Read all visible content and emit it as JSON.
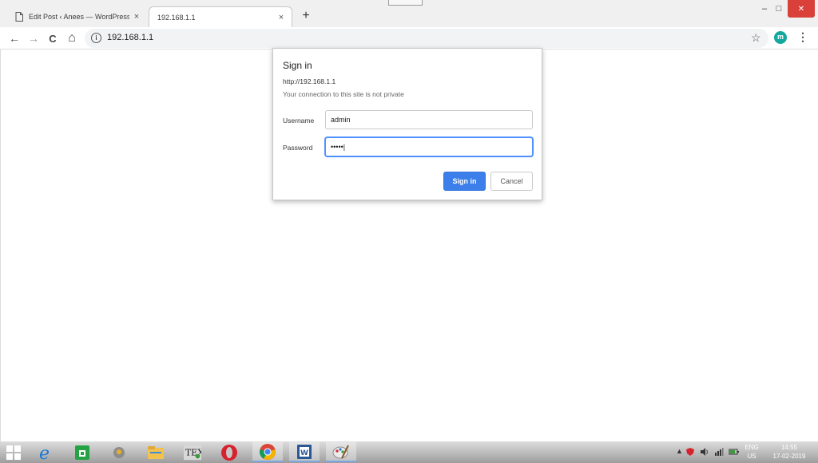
{
  "browser": {
    "tabs": [
      {
        "title": "Edit Post ‹ Anees — WordPress",
        "close": "×",
        "favicon": "page-icon",
        "active": false
      },
      {
        "title": "192.168.1.1",
        "close": "×",
        "favicon": "none",
        "active": true
      }
    ],
    "new_tab_label": "+",
    "window_controls": {
      "minimize": "–",
      "maximize": "□",
      "close": "✕"
    },
    "toolbar": {
      "back": "←",
      "forward": "→",
      "reload": "C",
      "home": "⌂",
      "info_icon": "i",
      "url": "192.168.1.1",
      "bookmark_star": "☆",
      "profile_initial": "m",
      "menu": "⋮"
    },
    "colors": {
      "profile_avatar": "#13a89e",
      "close_button": "#d9403a",
      "primary_button": "#3c7fea",
      "focus_ring": "#4d90fe"
    }
  },
  "dialog": {
    "title": "Sign in",
    "origin": "http://192.168.1.1",
    "warning": "Your connection to this site is not private",
    "username_label": "Username",
    "username_value": "admin",
    "password_label": "Password",
    "password_value": "•••••|",
    "submit_label": "Sign in",
    "cancel_label": "Cancel"
  },
  "taskbar": {
    "apps": [
      {
        "name": "start-button"
      },
      {
        "name": "internet-explorer"
      },
      {
        "name": "store"
      },
      {
        "name": "maps"
      },
      {
        "name": "file-explorer"
      },
      {
        "name": "tex"
      },
      {
        "name": "opera"
      },
      {
        "name": "chrome",
        "running": true
      },
      {
        "name": "word"
      },
      {
        "name": "paint"
      }
    ],
    "tray": {
      "language_top": "ENG",
      "language_bottom": "US",
      "time": "14:55",
      "date": "17-02-2019"
    }
  }
}
